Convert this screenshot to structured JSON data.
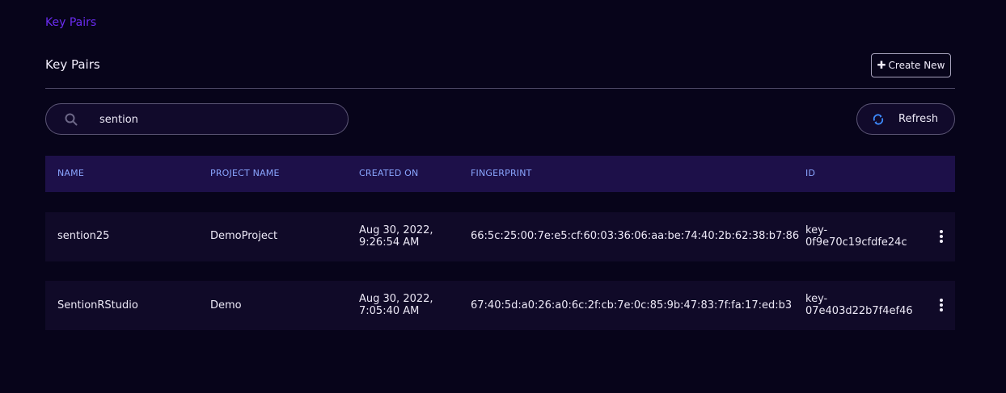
{
  "breadcrumb": "Key Pairs",
  "page_title": "Key Pairs",
  "create_button": {
    "icon": "plus-icon",
    "label": "Create New"
  },
  "search": {
    "icon": "search-icon",
    "value": "sention",
    "placeholder": ""
  },
  "refresh_button": {
    "icon": "refresh-icon",
    "label": "Refresh"
  },
  "table": {
    "columns": [
      "NAME",
      "PROJECT NAME",
      "CREATED ON",
      "FINGERPRINT",
      "ID"
    ],
    "rows": [
      {
        "name": "sention25",
        "project": "DemoProject",
        "created_line1": "Aug 30, 2022,",
        "created_line2": "9:26:54 AM",
        "fingerprint": "66:5c:25:00:7e:e5:cf:60:03:36:06:aa:be:74:40:2b:62:38:b7:86",
        "id_line1": "key-",
        "id_line2": "0f9e70c19cfdfe24c"
      },
      {
        "name": "SentionRStudio",
        "project": "Demo",
        "created_line1": "Aug 30, 2022,",
        "created_line2": "7:05:40 AM",
        "fingerprint": "67:40:5d:a0:26:a0:6c:2f:cb:7e:0c:85:9b:47:83:7f:fa:17:ed:b3",
        "id_line1": "key-",
        "id_line2": "07e403d22b7f4ef46"
      }
    ]
  },
  "colors": {
    "background": "#07041a",
    "breadcrumb": "#6a2cf0",
    "header_bg": "#1d1049",
    "header_text": "#8aa6ff",
    "row_bg": "#100a28"
  }
}
